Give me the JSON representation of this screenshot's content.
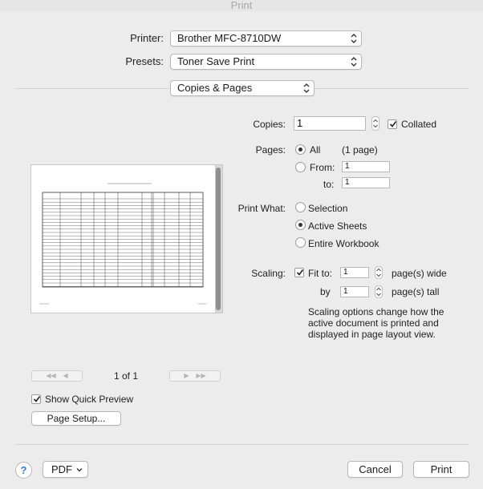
{
  "window": {
    "title": "Print"
  },
  "printer": {
    "label": "Printer:",
    "value": "Brother MFC-8710DW"
  },
  "presets": {
    "label": "Presets:",
    "value": "Toner Save Print"
  },
  "section": {
    "value": "Copies & Pages"
  },
  "copies": {
    "label": "Copies:",
    "value": "1",
    "collated_label": "Collated",
    "collated": true
  },
  "pages": {
    "label": "Pages:",
    "all_label": "All",
    "all_count": "(1 page)",
    "from_label": "From:",
    "from_value": "1",
    "to_label": "to:",
    "to_value": "1",
    "selected": "all"
  },
  "print_what": {
    "label": "Print What:",
    "options": [
      "Selection",
      "Active Sheets",
      "Entire Workbook"
    ],
    "selected": "Active Sheets"
  },
  "scaling": {
    "label": "Scaling:",
    "fit_label": "Fit to:",
    "fit_checked": true,
    "wide_value": "1",
    "wide_label": "page(s) wide",
    "by_label": "by",
    "tall_value": "1",
    "tall_label": "page(s) tall",
    "note": "Scaling options change how the active document is printed and displayed in page layout view."
  },
  "preview_nav": {
    "page_indicator": "1 of 1"
  },
  "quick_preview": {
    "label": "Show Quick Preview",
    "checked": true
  },
  "page_setup": {
    "label": "Page Setup..."
  },
  "footer": {
    "help_label": "?",
    "pdf_label": "PDF",
    "cancel_label": "Cancel",
    "print_label": "Print"
  },
  "colors": {
    "accent": "#2f7be8",
    "background": "#ececec"
  }
}
